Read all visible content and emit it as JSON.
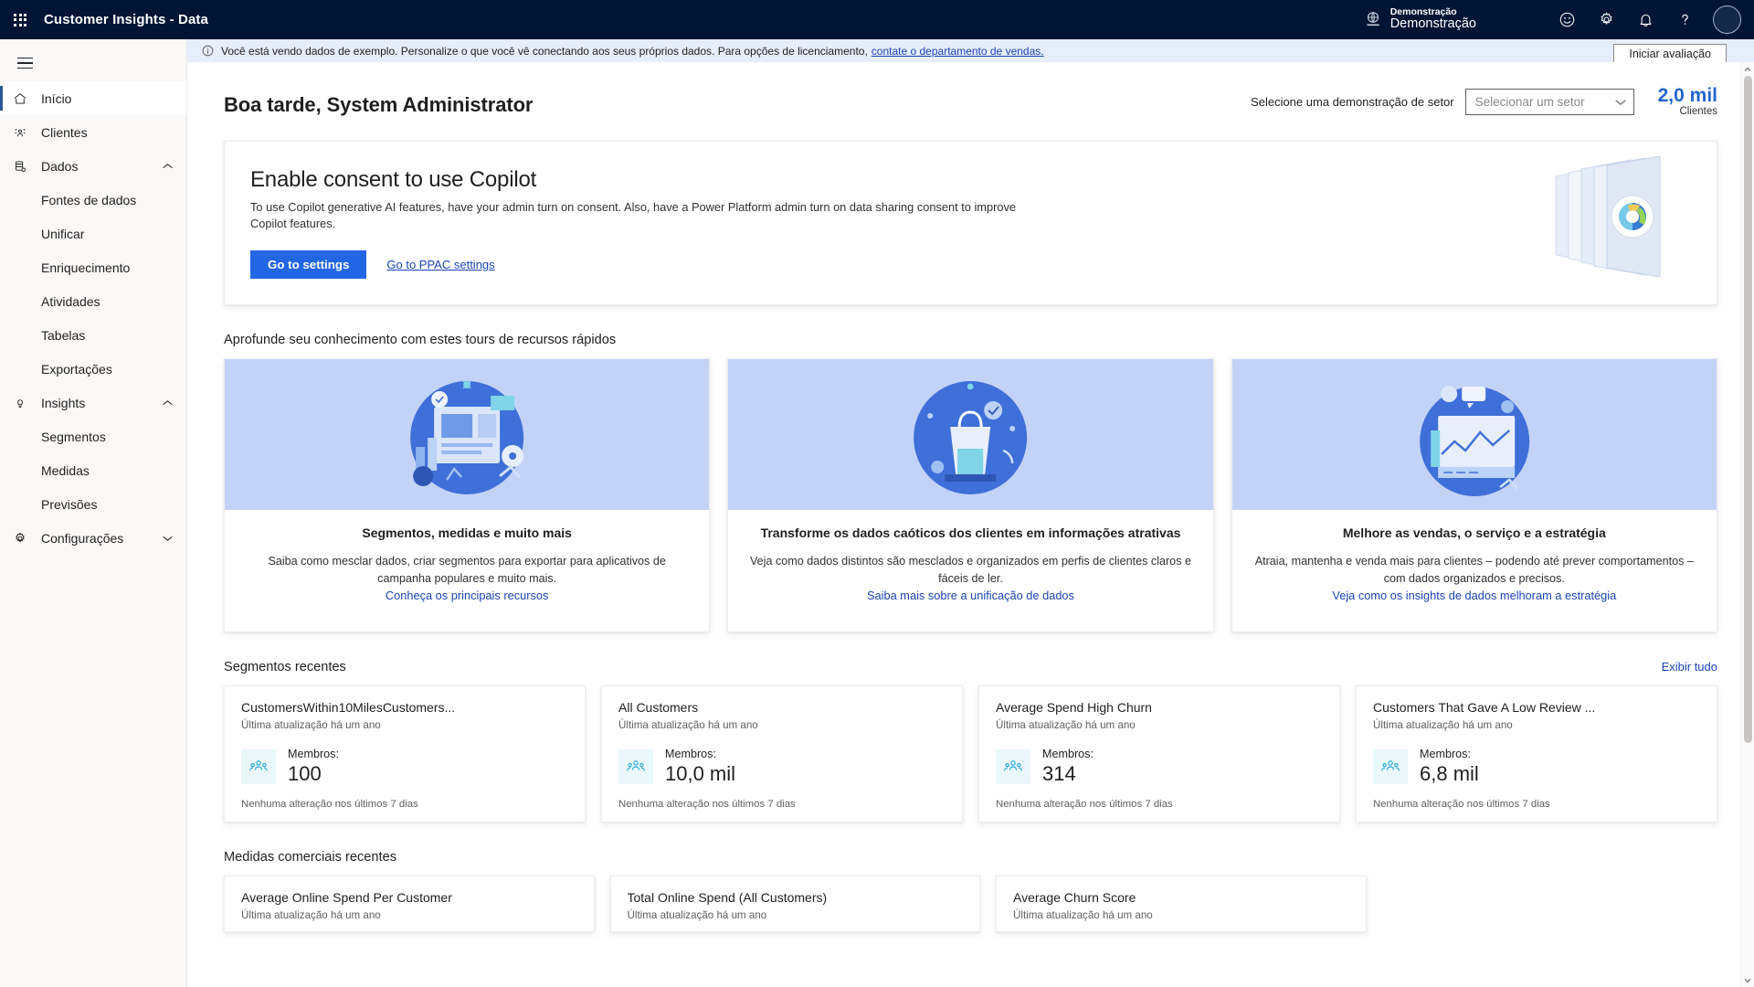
{
  "appbar": {
    "waffle_label": "app-launcher",
    "title": "Customer Insights - Data",
    "environment": {
      "line1": "Demonstração",
      "line2": "Demonstração"
    },
    "icons": [
      "smiley-icon",
      "gear-icon",
      "bell-icon",
      "question-icon",
      "avatar"
    ]
  },
  "notice": {
    "text": "Você está vendo dados de exemplo. Personalize o que você vê conectando aos seus próprios dados. Para opções de licenciamento,",
    "link": "contate o departamento de vendas.",
    "trial_button": "Iniciar avaliação"
  },
  "sidebar": {
    "items": [
      {
        "label": "Início",
        "icon": "home-icon",
        "level": 0,
        "selected": true,
        "chevron": ""
      },
      {
        "label": "Clientes",
        "icon": "customers-icon",
        "level": 0,
        "selected": false,
        "chevron": ""
      },
      {
        "label": "Dados",
        "icon": "database-icon",
        "level": 0,
        "selected": false,
        "chevron": "up"
      },
      {
        "label": "Fontes de dados",
        "icon": "",
        "level": 1,
        "selected": false,
        "chevron": ""
      },
      {
        "label": "Unificar",
        "icon": "",
        "level": 1,
        "selected": false,
        "chevron": ""
      },
      {
        "label": "Enriquecimento",
        "icon": "",
        "level": 1,
        "selected": false,
        "chevron": ""
      },
      {
        "label": "Atividades",
        "icon": "",
        "level": 1,
        "selected": false,
        "chevron": ""
      },
      {
        "label": "Tabelas",
        "icon": "",
        "level": 1,
        "selected": false,
        "chevron": ""
      },
      {
        "label": "Exportações",
        "icon": "",
        "level": 1,
        "selected": false,
        "chevron": ""
      },
      {
        "label": "Insights",
        "icon": "lightbulb-icon",
        "level": 0,
        "selected": false,
        "chevron": "up"
      },
      {
        "label": "Segmentos",
        "icon": "",
        "level": 1,
        "selected": false,
        "chevron": ""
      },
      {
        "label": "Medidas",
        "icon": "",
        "level": 1,
        "selected": false,
        "chevron": ""
      },
      {
        "label": "Previsões",
        "icon": "",
        "level": 1,
        "selected": false,
        "chevron": ""
      },
      {
        "label": "Configurações",
        "icon": "settings-gear-icon",
        "level": 0,
        "selected": false,
        "chevron": "down"
      }
    ]
  },
  "page": {
    "greeting": "Boa tarde, System Administrator",
    "sector_label": "Selecione uma demonstração de setor",
    "sector_placeholder": "Selecionar um setor",
    "kpi_value": "2,0 mil",
    "kpi_label": "Clientes"
  },
  "copilot": {
    "title": "Enable consent to use Copilot",
    "description": "To use Copilot generative AI features, have your admin turn on consent. Also, have a Power Platform admin turn on data sharing consent to improve Copilot features.",
    "primary_button": "Go to settings",
    "secondary_link": "Go to PPAC settings"
  },
  "tours": {
    "heading": "Aprofunde seu conhecimento com estes tours de recursos rápidos",
    "cards": [
      {
        "title": "Segmentos, medidas e muito mais",
        "description": "Saiba como mesclar dados, criar segmentos para exportar para aplicativos de campanha populares e muito mais.",
        "link": "Conheça os principais recursos"
      },
      {
        "title": "Transforme os dados caóticos dos clientes em informações atrativas",
        "description": "Veja como dados distintos são mesclados e organizados em perfis de clientes claros e fáceis de ler.",
        "link": "Saiba mais sobre a unificação de dados"
      },
      {
        "title": "Melhore as vendas, o serviço e a estratégia",
        "description": "Atraia, mantenha e venda mais para clientes – podendo até prever comportamentos – com dados organizados e precisos.",
        "link": "Veja como os insights de dados melhoram a estratégia"
      }
    ]
  },
  "segments": {
    "heading": "Segmentos recentes",
    "view_all": "Exibir tudo",
    "members_label": "Membros:",
    "cards": [
      {
        "title": "CustomersWithin10MilesCustomers...",
        "updated": "Última atualização há um ano",
        "members": "100",
        "footer": "Nenhuma alteração nos últimos 7 dias"
      },
      {
        "title": "All Customers",
        "updated": "Última atualização há um ano",
        "members": "10,0 mil",
        "footer": "Nenhuma alteração nos últimos 7 dias"
      },
      {
        "title": "Average Spend High Churn",
        "updated": "Última atualização há um ano",
        "members": "314",
        "footer": "Nenhuma alteração nos últimos 7 dias"
      },
      {
        "title": "Customers That Gave A Low Review ...",
        "updated": "Última atualização há um ano",
        "members": "6,8 mil",
        "footer": "Nenhuma alteração nos últimos 7 dias"
      }
    ]
  },
  "measures": {
    "heading": "Medidas comerciais recentes",
    "cards": [
      {
        "title": "Average Online Spend Per Customer",
        "updated": "Última atualização há um ano"
      },
      {
        "title": "Total Online Spend (All Customers)",
        "updated": "Última atualização há um ano"
      },
      {
        "title": "Average Churn Score",
        "updated": "Última atualização há um ano"
      }
    ]
  },
  "colors": {
    "appbar": "#001433",
    "accent": "#2266e3",
    "link": "#1b45b5",
    "notice_bg": "#e6edfb",
    "kpi": "#2266cc"
  }
}
